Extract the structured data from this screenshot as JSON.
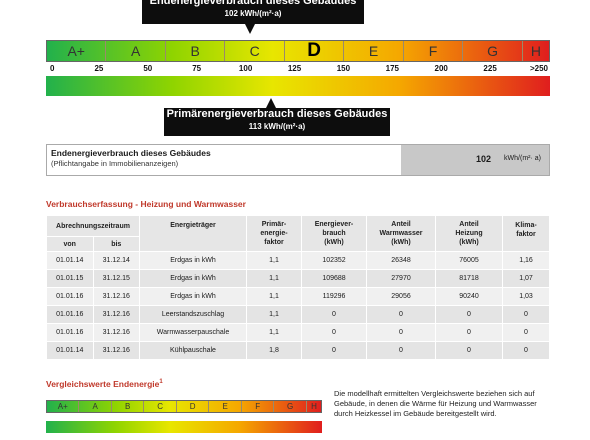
{
  "top_callout": {
    "title": "Endenergieverbrauch dieses Gebäudes",
    "value": "102 kWh/(m²·a)"
  },
  "scale": {
    "classes": [
      "A+",
      "A",
      "B",
      "C",
      "D",
      "E",
      "F",
      "G",
      "H"
    ],
    "selected_class": "D",
    "ticks": [
      "0",
      "25",
      "50",
      "75",
      "100",
      "125",
      "150",
      "175",
      "200",
      "225",
      ">250"
    ],
    "end_energy_value": 102,
    "primary_energy_value": 113,
    "max_value": 250
  },
  "bottom_callout": {
    "title": "Primärenergieverbrauch dieses Gebäudes",
    "value": "113 kWh/(m²·a)"
  },
  "summary": {
    "label": "Endenergieverbrauch dieses Gebäudes",
    "sublabel": "(Pflichtangabe in Immobilienanzeigen)",
    "value": "102",
    "unit": "kWh/(m²· a)"
  },
  "consumption": {
    "title": "Verbrauchserfassung - Heizung und Warmwasser",
    "headers": {
      "period": "Abrechnungszeitraum",
      "from": "von",
      "to": "bis",
      "carrier": "Energieträger",
      "factor_l1": "Primär-",
      "factor_l2": "energie-",
      "factor_l3": "faktor",
      "energy_l1": "Energiever-",
      "energy_l2": "brauch",
      "energy_l3": "(kWh)",
      "ww_l1": "Anteil",
      "ww_l2": "Warmwasser",
      "ww_l3": "(kWh)",
      "heat_l1": "Anteil",
      "heat_l2": "Heizung",
      "heat_l3": "(kWh)",
      "climate_l1": "Klima-",
      "climate_l2": "faktor"
    },
    "rows": [
      [
        "01.01.14",
        "31.12.14",
        "Erdgas in kWh",
        "1,1",
        "102352",
        "26348",
        "76005",
        "1,16"
      ],
      [
        "01.01.15",
        "31.12.15",
        "Erdgas in kWh",
        "1,1",
        "109688",
        "27970",
        "81718",
        "1,07"
      ],
      [
        "01.01.16",
        "31.12.16",
        "Erdgas in kWh",
        "1,1",
        "119296",
        "29056",
        "90240",
        "1,03"
      ],
      [
        "01.01.16",
        "31.12.16",
        "Leerstandszuschlag",
        "1,1",
        "0",
        "0",
        "0",
        "0"
      ],
      [
        "01.01.16",
        "31.12.16",
        "Warmwasserpauschale",
        "1,1",
        "0",
        "0",
        "0",
        "0"
      ],
      [
        "01.01.14",
        "31.12.16",
        "Kühlpauschale",
        "1,8",
        "0",
        "0",
        "0",
        "0"
      ]
    ]
  },
  "comparison": {
    "title": "Vergleichswerte Endenergie",
    "footnote_mark": "1",
    "classes": [
      "A+",
      "A",
      "B",
      "C",
      "D",
      "E",
      "F",
      "G",
      "H"
    ],
    "note": "Die modellhaft ermittelten Vergleichswerte beziehen sich auf Gebäude, in denen die Wärme für Heizung und Warmwasser durch Heizkessel im Gebäude bereitgestellt wird."
  },
  "colors": {
    "grad_start": "#22b14c",
    "grad_mid": "#e8e600",
    "grad_end": "#e01e1e",
    "accent": "#c0392b"
  }
}
